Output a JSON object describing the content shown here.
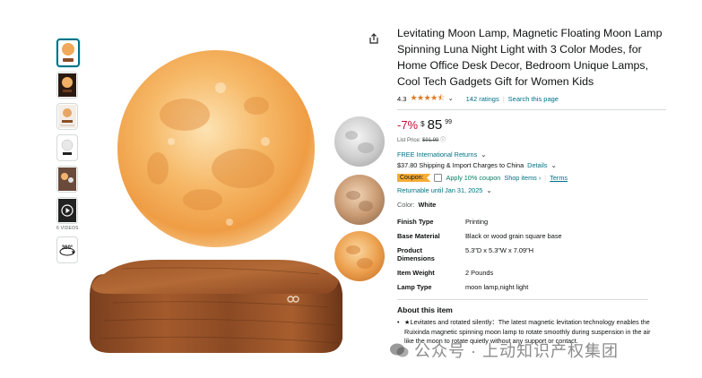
{
  "product": {
    "title": "Levitating Moon Lamp, Magnetic Floating Moon Lamp Spinning Luna Night Light with 3 Color Modes, for Home Office Desk Decor, Bedroom Unique Lamps, Cool Tech Gadgets Gift for Women Kids"
  },
  "gallery": {
    "videos_label": "6 VIDEOS",
    "view_360_label": "360°"
  },
  "rating": {
    "value": "4.3",
    "stars_glyphs": "★★★★⯪",
    "ratings_count": "142 ratings",
    "search_link": "Search this page"
  },
  "price": {
    "discount": "-7%",
    "symbol": "$",
    "whole": "85",
    "fraction": "99",
    "list_label": "List Price:",
    "list_value": "$91.99"
  },
  "shipping": {
    "returns_link": "FREE International Returns",
    "charges": "$37.80 Shipping & Import Charges to China",
    "details_link": "Details"
  },
  "coupon": {
    "badge": "Coupon:",
    "apply_text": "Apply 10% coupon",
    "shop_items": "Shop items ›",
    "terms": "Terms"
  },
  "returnable": "Returnable until Jan 31, 2025",
  "color": {
    "label": "Color:",
    "value": "White"
  },
  "specs": [
    {
      "key": "Finish Type",
      "value": "Printing"
    },
    {
      "key": "Base Material",
      "value": "Black or wood grain square base"
    },
    {
      "key": "Product Dimensions",
      "value": "5.3\"D x 5.3\"W x 7.09\"H"
    },
    {
      "key": "Item Weight",
      "value": "2 Pounds"
    },
    {
      "key": "Lamp Type",
      "value": "moon lamp,night light"
    }
  ],
  "about": {
    "title": "About this item",
    "bullet": "★Levitates and rotated silently：The latest magnetic levitation technology enables the Ruixinda magnetic spinning moon lamp to rotate smoothly during suspension in the air like the moon to rotate quietly without any support or contact."
  },
  "watermark": "公众号 · 上动知识产权集团",
  "colors": {
    "link": "#007185",
    "discount": "#cc0c39",
    "star": "#de7921",
    "coupon_badge": "#f7ac35",
    "coupon_text": "#067d62"
  }
}
